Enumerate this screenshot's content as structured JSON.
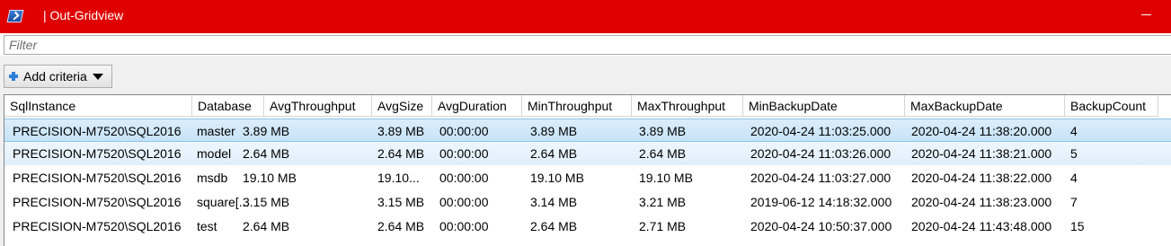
{
  "window": {
    "title": "| Out-Gridview",
    "icon": "powershell-icon"
  },
  "filter": {
    "placeholder": "Filter",
    "value": ""
  },
  "toolbar": {
    "add_criteria_label": "Add criteria"
  },
  "table": {
    "columns": [
      "SqlInstance",
      "Database",
      "AvgThroughput",
      "AvgSize",
      "AvgDuration",
      "MinThroughput",
      "MaxThroughput",
      "MinBackupDate",
      "MaxBackupDate",
      "BackupCount"
    ],
    "rows": [
      [
        "PRECISION-M7520\\SQL2016",
        "master",
        "3.89 MB",
        "3.89 MB",
        "00:00:00",
        "3.89 MB",
        "3.89 MB",
        "2020-04-24 11:03:25.000",
        "2020-04-24 11:38:20.000",
        "4"
      ],
      [
        "PRECISION-M7520\\SQL2016",
        "model",
        "2.64 MB",
        "2.64 MB",
        "00:00:00",
        "2.64 MB",
        "2.64 MB",
        "2020-04-24 11:03:26.000",
        "2020-04-24 11:38:21.000",
        "5"
      ],
      [
        "PRECISION-M7520\\SQL2016",
        "msdb",
        "19.10 MB",
        "19.10...",
        "00:00:00",
        "19.10 MB",
        "19.10 MB",
        "2020-04-24 11:03:27.000",
        "2020-04-24 11:38:22.000",
        "4"
      ],
      [
        "PRECISION-M7520\\SQL2016",
        "square[...",
        "3.15 MB",
        "3.15 MB",
        "00:00:00",
        "3.14 MB",
        "3.21 MB",
        "2019-06-12 14:18:32.000",
        "2020-04-24 11:38:23.000",
        "7"
      ],
      [
        "PRECISION-M7520\\SQL2016",
        "test",
        "2.64 MB",
        "2.64 MB",
        "00:00:00",
        "2.64 MB",
        "2.71 MB",
        "2020-04-24 10:50:37.000",
        "2020-04-24 11:43:48.000",
        "15"
      ]
    ]
  },
  "colors": {
    "titlebar": "#e00000",
    "selected_row": "#c6e3f8"
  }
}
